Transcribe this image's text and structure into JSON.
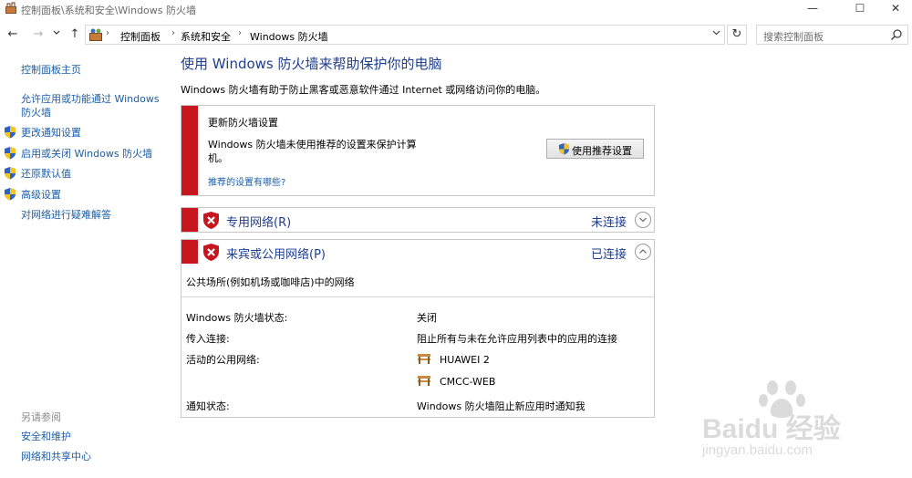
{
  "window": {
    "title": "控制面板\\系统和安全\\Windows 防火墙",
    "minimize": "—",
    "maximize": "☐",
    "close": "✕"
  },
  "nav": {
    "back": "←",
    "forward": "→",
    "recent": "⌄",
    "up": "↑",
    "breadcrumbs": [
      "控制面板",
      "系统和安全",
      "Windows 防火墙"
    ],
    "refresh": "↻",
    "search_placeholder": "搜索控制面板"
  },
  "left_pane": {
    "home": "控制面板主页",
    "items": [
      {
        "label": "允许应用或功能通过 Windows 防火墙",
        "line1": "允许应用或功能通过 Windows",
        "line2": "防火墙",
        "shield": false
      },
      {
        "label": "更改通知设置",
        "shield": true
      },
      {
        "label": "启用或关闭 Windows 防火墙",
        "shield": true
      },
      {
        "label": "还原默认值",
        "shield": true
      },
      {
        "label": "高级设置",
        "shield": true
      },
      {
        "label": "对网络进行疑难解答",
        "shield": false
      }
    ],
    "see_also": "另请参阅",
    "see_also_items": [
      "安全和维护",
      "网络和共享中心"
    ]
  },
  "main": {
    "title": "使用 Windows 防火墙来帮助保护你的电脑",
    "description": "Windows 防火墙有助于防止黑客或恶意软件通过 Internet 或网络访问你的电脑。",
    "update": {
      "title": "更新防火墙设置",
      "text": "Windows 防火墙未使用推荐的设置来保护计算机。",
      "button": "使用推荐设置",
      "link": "推荐的设置有哪些?"
    },
    "private_network": {
      "name": "专用网络(R)",
      "status": "未连接",
      "expanded": false
    },
    "public_network": {
      "name": "来宾或公用网络(P)",
      "status": "已连接",
      "expanded": true,
      "description": "公共场所(例如机场或咖啡店)中的网络",
      "rows": [
        {
          "label": "Windows 防火墙状态:",
          "value": "关闭"
        },
        {
          "label": "传入连接:",
          "value": "阻止所有与未在允许应用列表中的应用的连接"
        },
        {
          "label": "活动的公用网络:",
          "value": ""
        },
        {
          "label": "通知状态:",
          "value": "Windows 防火墙阻止新应用时通知我"
        }
      ],
      "active_networks": [
        "HUAWEI  2",
        "CMCC-WEB"
      ]
    }
  },
  "watermark": {
    "brand": "Baidu 经验",
    "url": "jingyan.baidu.com"
  },
  "colors": {
    "accent_red": "#c8161e",
    "link_blue": "#1a5ea8",
    "title_blue": "#1e3e8f"
  }
}
